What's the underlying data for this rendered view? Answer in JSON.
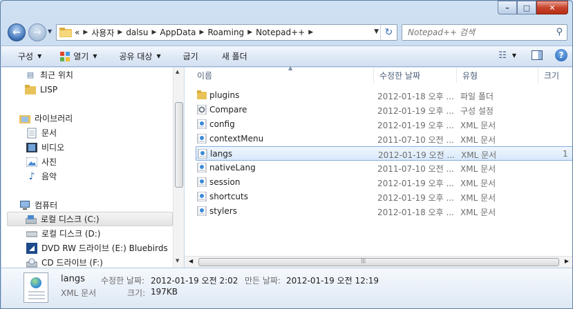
{
  "window": {
    "caption_minimize": "–",
    "caption_maximize": "□",
    "caption_close": "✕"
  },
  "address_bar": {
    "prefix": "«",
    "crumbs": [
      "사용자",
      "dalsu",
      "AppData",
      "Roaming",
      "Notepad++"
    ]
  },
  "search": {
    "placeholder": "Notepad++ 검색"
  },
  "toolbar": {
    "organize": "구성",
    "open": "열기",
    "share": "공유 대상",
    "burn": "굽기",
    "new_folder": "새 폴더",
    "help": "?"
  },
  "nav": {
    "items": [
      {
        "label": "최근 위치",
        "icon": "recent-places-icon"
      },
      {
        "label": "LISP",
        "icon": "folder-icon"
      },
      {
        "label": "라이브러리",
        "icon": "library-icon"
      },
      {
        "label": "문서",
        "icon": "documents-icon"
      },
      {
        "label": "비디오",
        "icon": "video-icon"
      },
      {
        "label": "사진",
        "icon": "pictures-icon"
      },
      {
        "label": "음악",
        "icon": "music-icon"
      },
      {
        "label": "컴퓨터",
        "icon": "computer-icon"
      },
      {
        "label": "로컬 디스크 (C:)",
        "icon": "local-disk-icon"
      },
      {
        "label": "로컬 디스크 (D:)",
        "icon": "local-disk-icon"
      },
      {
        "label": "DVD RW 드라이브 (E:) Bluebirds",
        "icon": "dvd-drive-icon"
      },
      {
        "label": "CD 드라이브 (F:)",
        "icon": "cd-drive-icon"
      }
    ]
  },
  "columns": {
    "name": "이름",
    "date": "수정한 날짜",
    "type": "유형",
    "size": "크기"
  },
  "files": [
    {
      "name": "plugins",
      "date": "2012-01-18 오후 ...",
      "type": "파일 폴더",
      "icon": "folder-icon"
    },
    {
      "name": "Compare",
      "date": "2012-01-19 오후 ...",
      "type": "구성 설정",
      "icon": "settings-file-icon"
    },
    {
      "name": "config",
      "date": "2012-01-19 오후 ...",
      "type": "XML 문서",
      "icon": "xml-file-icon"
    },
    {
      "name": "contextMenu",
      "date": "2011-07-10 오전 ...",
      "type": "XML 문서",
      "icon": "xml-file-icon"
    },
    {
      "name": "langs",
      "date": "2012-01-19 오전 ...",
      "type": "XML 문서",
      "icon": "xml-file-icon",
      "size_fragment": "1"
    },
    {
      "name": "nativeLang",
      "date": "2011-07-10 오전 ...",
      "type": "XML 문서",
      "icon": "xml-file-icon"
    },
    {
      "name": "session",
      "date": "2012-01-19 오후 ...",
      "type": "XML 문서",
      "icon": "xml-file-icon"
    },
    {
      "name": "shortcuts",
      "date": "2012-01-19 오후 ...",
      "type": "XML 문서",
      "icon": "xml-file-icon"
    },
    {
      "name": "stylers",
      "date": "2012-01-18 오후 ...",
      "type": "XML 문서",
      "icon": "xml-file-icon"
    }
  ],
  "details": {
    "name": "langs",
    "type": "XML 문서",
    "modified_label": "수정한 날짜:",
    "modified_value": "2012-01-19 오전 2:02",
    "created_label": "만든 날짜:",
    "created_value": "2012-01-19 오전 12:19",
    "size_label": "크기:",
    "size_value": "197KB"
  },
  "colors": {
    "accent": "#3a6eb5",
    "selection_border": "#84acdd",
    "close_button": "#c8442b"
  }
}
